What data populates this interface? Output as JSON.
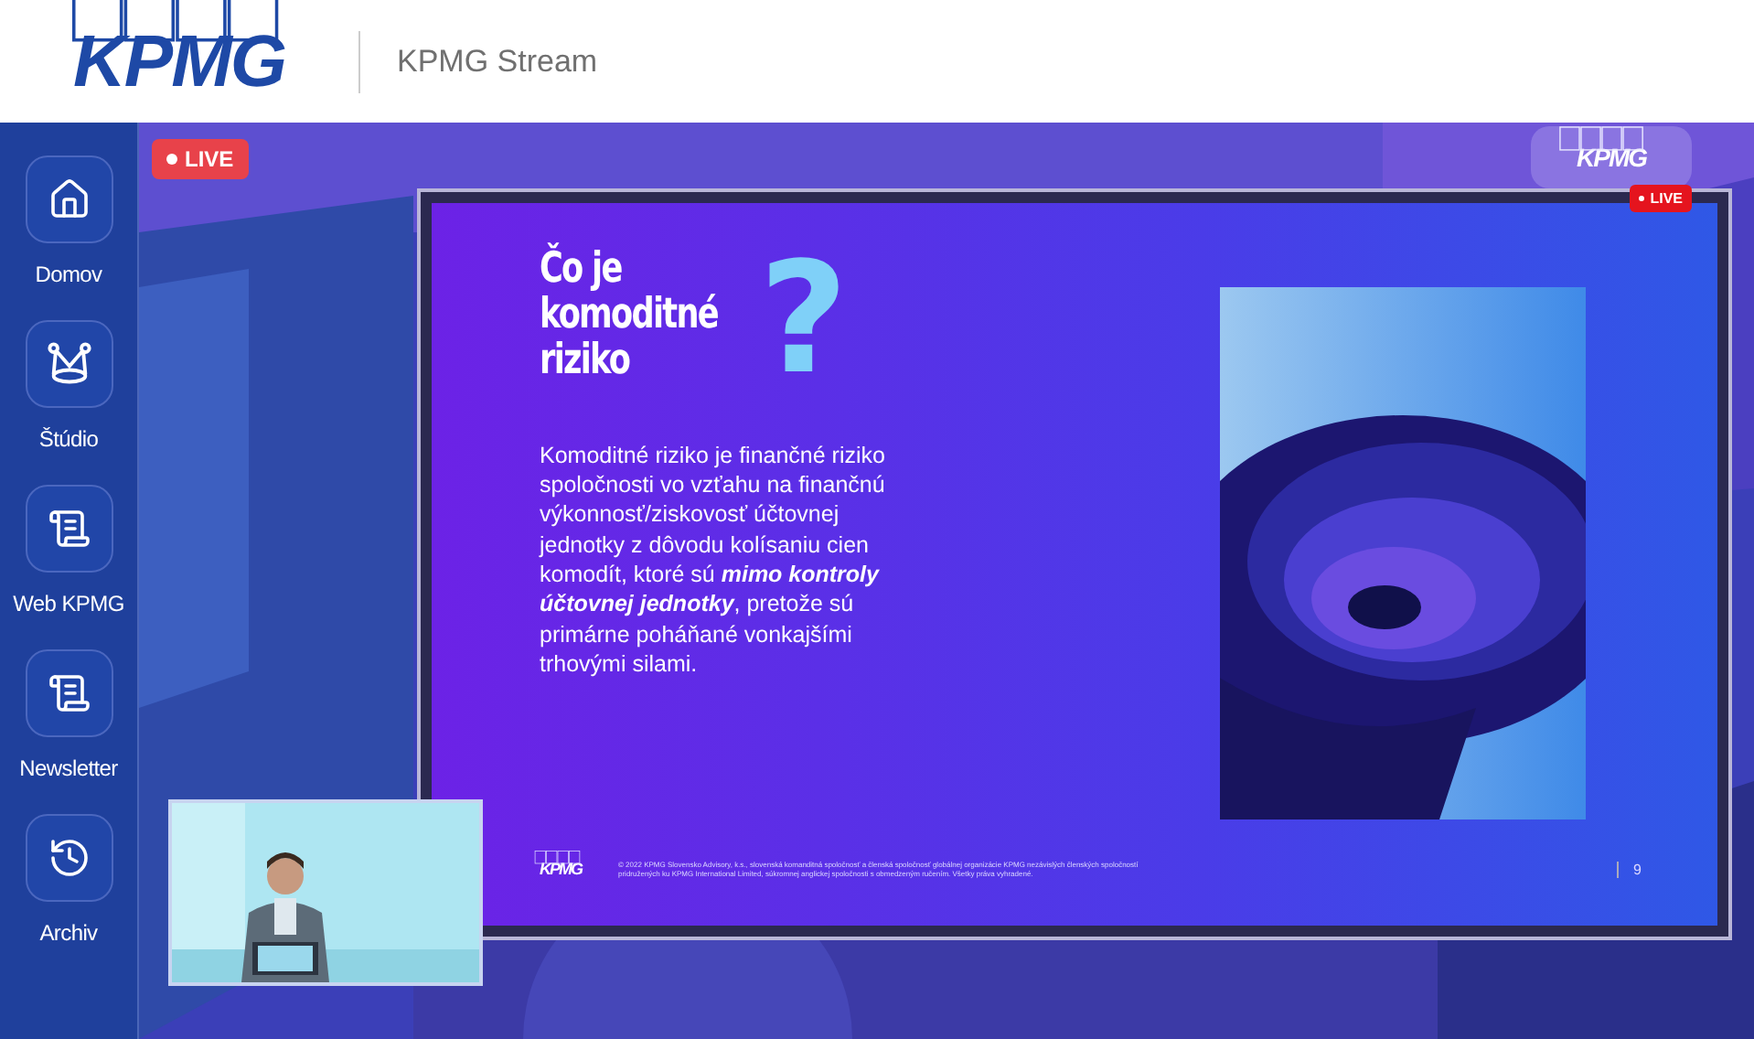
{
  "header": {
    "logo": "KPMG",
    "title": "KPMG Stream"
  },
  "sidebar": {
    "items": [
      {
        "label": "Domov",
        "kind": "home"
      },
      {
        "label": "Štúdio",
        "kind": "studio"
      },
      {
        "label": "Web KPMG",
        "kind": "document"
      },
      {
        "label": "Newsletter",
        "kind": "document"
      },
      {
        "label": "Archiv",
        "kind": "history"
      }
    ]
  },
  "stream": {
    "live_badge": "LIVE",
    "channel_logo": "KPMG",
    "channel_live": "LIVE",
    "slide": {
      "title_lines": [
        "Čo je",
        "komoditné",
        "riziko"
      ],
      "title_mark": "?",
      "body": "Komoditné riziko je finančné riziko spoločnosti vo vzťahu na finančnú výkonnosť/ziskovosť účtovnej jednotky z dôvodu kolísaniu cien komodít, ktoré sú **mimo kontroly účtovnej jednotky**, pretože sú primárne poháňané vonkajšími trhovými silami.",
      "footer_logo": "KPMG",
      "footer_text": "© 2022 KPMG Slovensko Advisory, k.s., slovenská komanditná spoločnosť a členská spoločnosť globálnej organizácie KPMG nezávislých členských spoločností pridružených ku KPMG International Limited, súkromnej anglickej spoločnosti s obmedzeným ručením. Všetky práva vyhradené.",
      "page": "9"
    }
  }
}
